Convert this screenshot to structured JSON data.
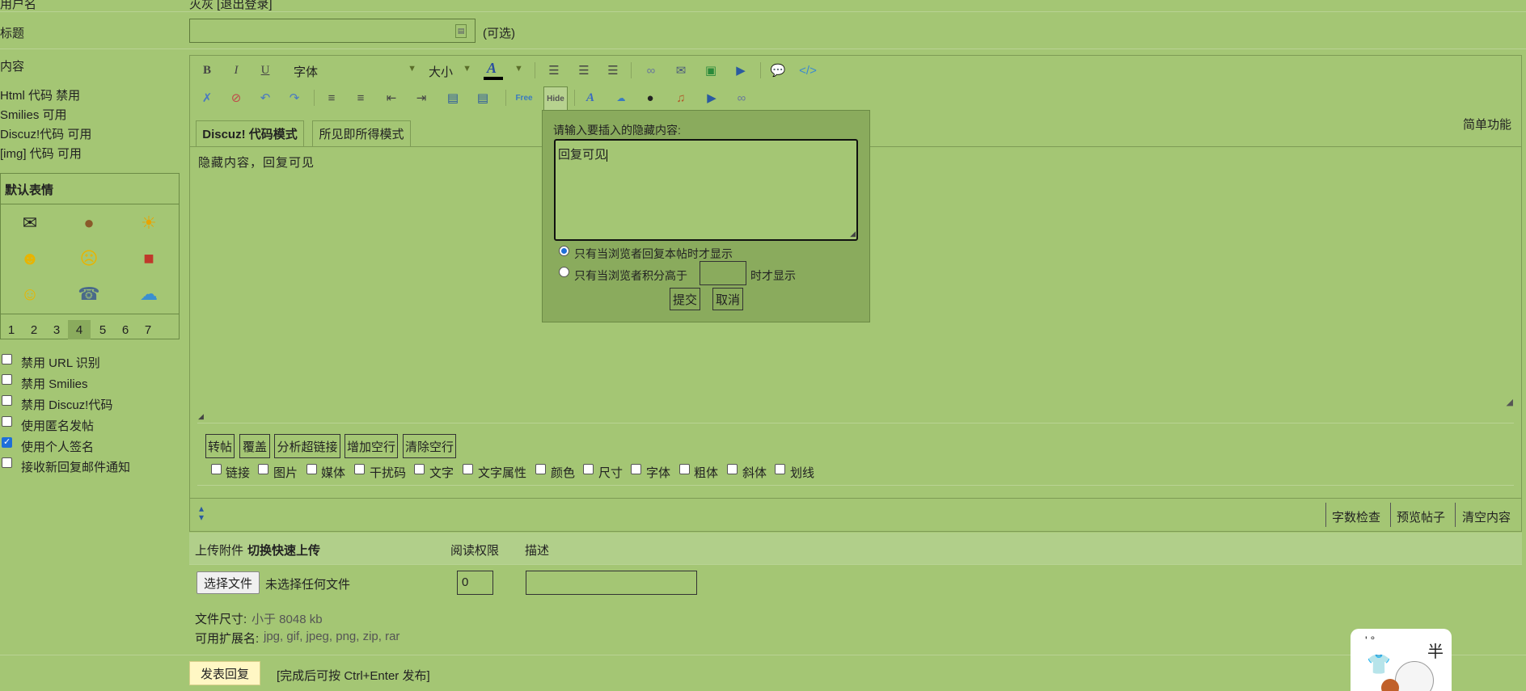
{
  "top": {
    "user_label": "用户名",
    "user_value": "灭灰 [退出登录]"
  },
  "title_row": {
    "label": "标题",
    "optional": "(可选)"
  },
  "content_row": {
    "label": "内容",
    "info": [
      "Html 代码 禁用",
      "Smilies 可用",
      "Discuz!代码 可用",
      "[img] 代码 可用"
    ]
  },
  "smileys": {
    "header": "默认表情",
    "pages": [
      "1",
      "2",
      "3",
      "4",
      "5",
      "6",
      "7"
    ],
    "current_page": "4"
  },
  "options": [
    {
      "label": "禁用 URL 识别",
      "checked": false
    },
    {
      "label": "禁用 Smilies",
      "checked": false
    },
    {
      "label": "禁用 Discuz!代码",
      "checked": false
    },
    {
      "label": "使用匿名发帖",
      "checked": false
    },
    {
      "label": "使用个人签名",
      "checked": true
    },
    {
      "label": "接收新回复邮件通知",
      "checked": false
    }
  ],
  "toolbar": {
    "bold": "B",
    "italic": "I",
    "underline": "U",
    "font": "字体",
    "size": "大小",
    "simple_mode": "简单功能"
  },
  "tabs": {
    "code_mode": "Discuz! 代码模式",
    "wysiwyg_mode": "所见即所得模式"
  },
  "editor": {
    "content": "隐藏内容，回复可见"
  },
  "popup": {
    "prompt": "请输入要插入的隐藏内容:",
    "value": "回复可见",
    "option_reply": "只有当浏览者回复本帖时才显示",
    "option_credit_prefix": "只有当浏览者积分高于",
    "option_credit_suffix": "时才显示",
    "submit": "提交",
    "cancel": "取消"
  },
  "action_buttons": [
    "转帖",
    "覆盖",
    "分析超链接",
    "增加空行",
    "清除空行"
  ],
  "format_filters": [
    "链接",
    "图片",
    "媒体",
    "干扰码",
    "文字",
    "文字属性",
    "颜色",
    "尺寸",
    "字体",
    "粗体",
    "斜体",
    "划线"
  ],
  "footer_tools": {
    "word_check": "字数检查",
    "preview": "预览帖子",
    "clear": "清空内容"
  },
  "upload": {
    "header_label": "上传附件",
    "header_bold": "切换快速上传",
    "perm_col": "阅读权限",
    "desc_col": "描述",
    "choose_button": "选择文件",
    "no_file": "未选择任何文件",
    "perm_value": "0",
    "size_label": "文件尺寸:",
    "size_value": "小于 8048 kb",
    "ext_label": "可用扩展名:",
    "ext_value": "jpg, gif, jpeg, png, zip, rar"
  },
  "submit": {
    "button": "发表回复",
    "hint": "[完成后可按 Ctrl+Enter 发布]"
  },
  "corner_widget": {
    "text": "半"
  },
  "colors": {
    "bg": "#a4c674",
    "popup_bg": "#8aab5d",
    "submit_bg": "#fff7c4",
    "accent": "#1e6fd9"
  }
}
